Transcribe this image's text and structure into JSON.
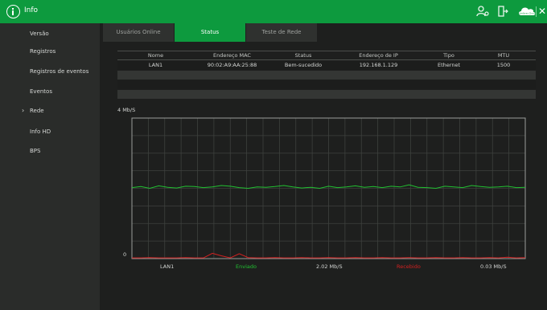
{
  "window": {
    "title": "Info"
  },
  "icons": {
    "user": "user-icon",
    "logout": "logout-icon",
    "cloud": "cloud-icon",
    "cloud_text": "Intelbras Cloud",
    "close": "close-icon"
  },
  "colors": {
    "accent": "#0d9a3e",
    "sent": "#21c131",
    "received": "#d22020"
  },
  "sidebar": {
    "items": [
      {
        "label": "Versão"
      },
      {
        "label": "Registros"
      },
      {
        "label": "Registros de eventos"
      },
      {
        "label": "Eventos"
      },
      {
        "label": "Rede",
        "selected": true
      },
      {
        "label": "Info HD"
      },
      {
        "label": "BPS"
      }
    ]
  },
  "tabs": [
    {
      "label": "Usuários Online",
      "active": false
    },
    {
      "label": "Status",
      "active": true
    },
    {
      "label": "Teste de Rede",
      "active": false
    }
  ],
  "table": {
    "headers": [
      "Nome",
      "Endereço MAC",
      "Status",
      "Endereço de IP",
      "Tipo",
      "MTU"
    ],
    "rows": [
      [
        "LAN1",
        "90:02:A9:AA:25:88",
        "Bem-sucedido",
        "192.168.1.129",
        "Ethernet",
        "1500"
      ]
    ]
  },
  "graph": {
    "y_max_label": "4 Mb/S",
    "y_min_label": "0"
  },
  "chart_data": {
    "type": "line",
    "ylim": [
      0,
      4
    ],
    "series": [
      {
        "name": "Enviado",
        "values": [
          2.02,
          2.05,
          2.0,
          2.07,
          2.03,
          2.01,
          2.06,
          2.05,
          2.02,
          2.04,
          2.08,
          2.06,
          2.02,
          2.0,
          2.04,
          2.03,
          2.05,
          2.08,
          2.04,
          2.01,
          2.03,
          2.0,
          2.06,
          2.02,
          2.04,
          2.07,
          2.03,
          2.05,
          2.02,
          2.06,
          2.04,
          2.1,
          2.03,
          2.02,
          2.0,
          2.06,
          2.04,
          2.02,
          2.08,
          2.05,
          2.03,
          2.04,
          2.06,
          2.02,
          2.03
        ]
      },
      {
        "name": "Recebido",
        "values": [
          0.02,
          0.02,
          0.03,
          0.02,
          0.02,
          0.02,
          0.03,
          0.02,
          0.02,
          0.15,
          0.08,
          0.02,
          0.14,
          0.03,
          0.02,
          0.02,
          0.03,
          0.02,
          0.02,
          0.03,
          0.02,
          0.02,
          0.03,
          0.02,
          0.02,
          0.03,
          0.02,
          0.02,
          0.03,
          0.02,
          0.02,
          0.03,
          0.02,
          0.02,
          0.03,
          0.02,
          0.02,
          0.03,
          0.02,
          0.02,
          0.03,
          0.02,
          0.04,
          0.02,
          0.03
        ]
      }
    ]
  },
  "legend": {
    "interface": "LAN1",
    "sent_label": "Enviado",
    "sent_value": "2.02 Mb/S",
    "received_label": "Recebido",
    "received_value": "0.03 Mb/S"
  }
}
